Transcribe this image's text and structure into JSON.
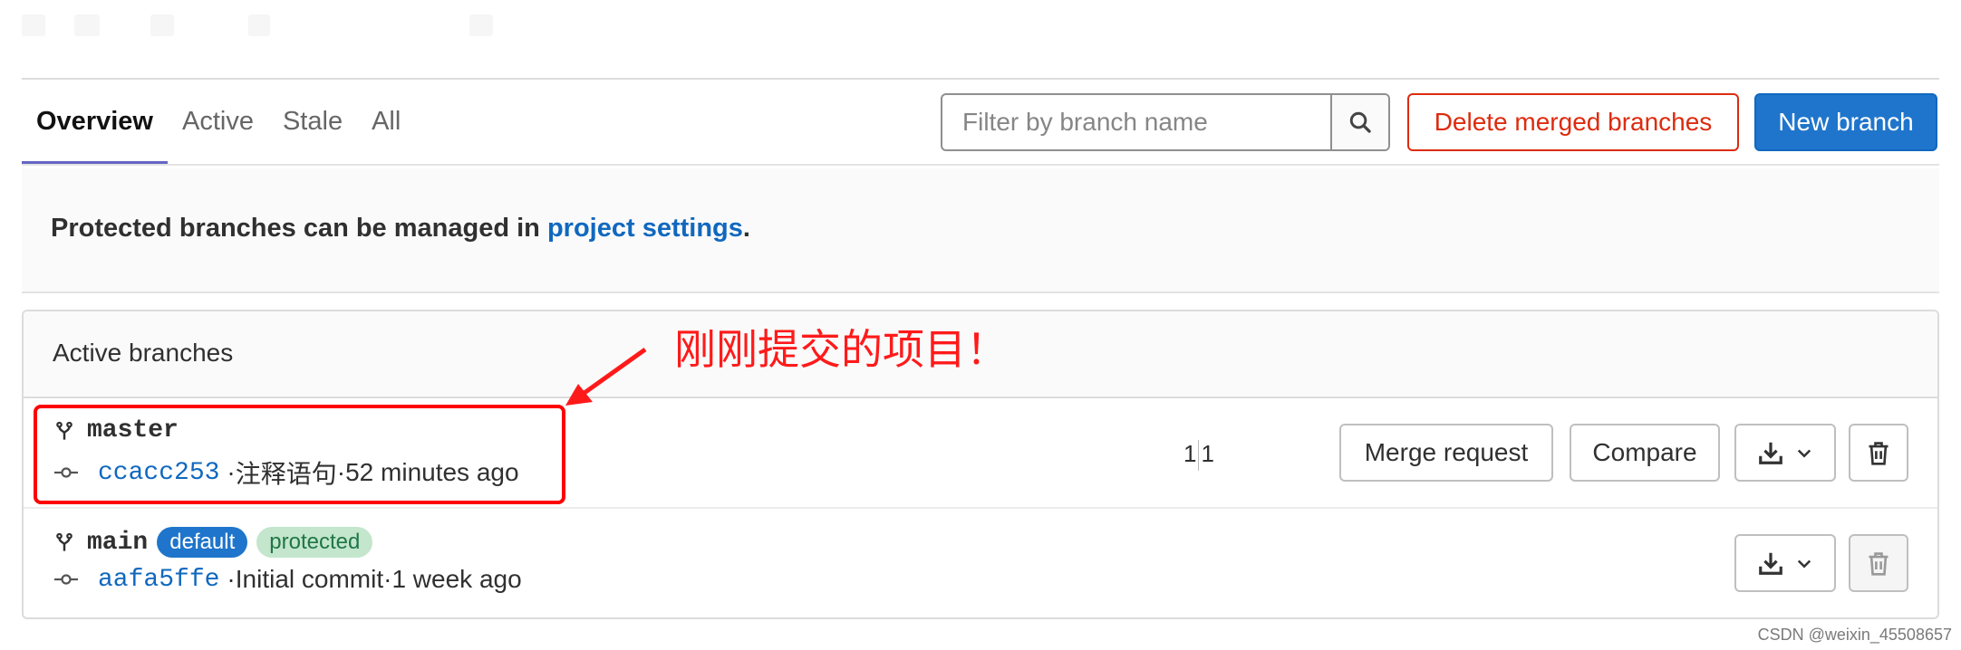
{
  "tabs": [
    {
      "label": "Overview",
      "active": true
    },
    {
      "label": "Active",
      "active": false
    },
    {
      "label": "Stale",
      "active": false
    },
    {
      "label": "All",
      "active": false
    }
  ],
  "search": {
    "placeholder": "Filter by branch name",
    "icon": "search-icon"
  },
  "actions": {
    "delete_merged": "Delete merged branches",
    "new_branch": "New branch"
  },
  "notice": {
    "text": "Protected branches can be managed in ",
    "link": "project settings",
    "suffix": "."
  },
  "panel": {
    "title": "Active branches"
  },
  "branches": [
    {
      "name": "master",
      "sha": "ccacc253",
      "message": "注释语句",
      "age": "52 minutes ago",
      "divergence_behind": "1",
      "divergence_ahead": "1",
      "merge_request_label": "Merge request",
      "compare_label": "Compare"
    },
    {
      "name": "main",
      "badge_default": "default",
      "badge_protected": "protected",
      "sha": "aafa5ffe",
      "message": "Initial commit",
      "age": "1 week ago"
    }
  ],
  "separator": " · ",
  "annotation": {
    "text": "刚刚提交的项目！",
    "color": "#ff1a1a"
  },
  "watermark": "CSDN @weixin_45508657",
  "colors": {
    "primary": "#1f75cb",
    "danger": "#dd2b0e",
    "link": "#1068bf",
    "tab_underline": "#6666c4"
  }
}
